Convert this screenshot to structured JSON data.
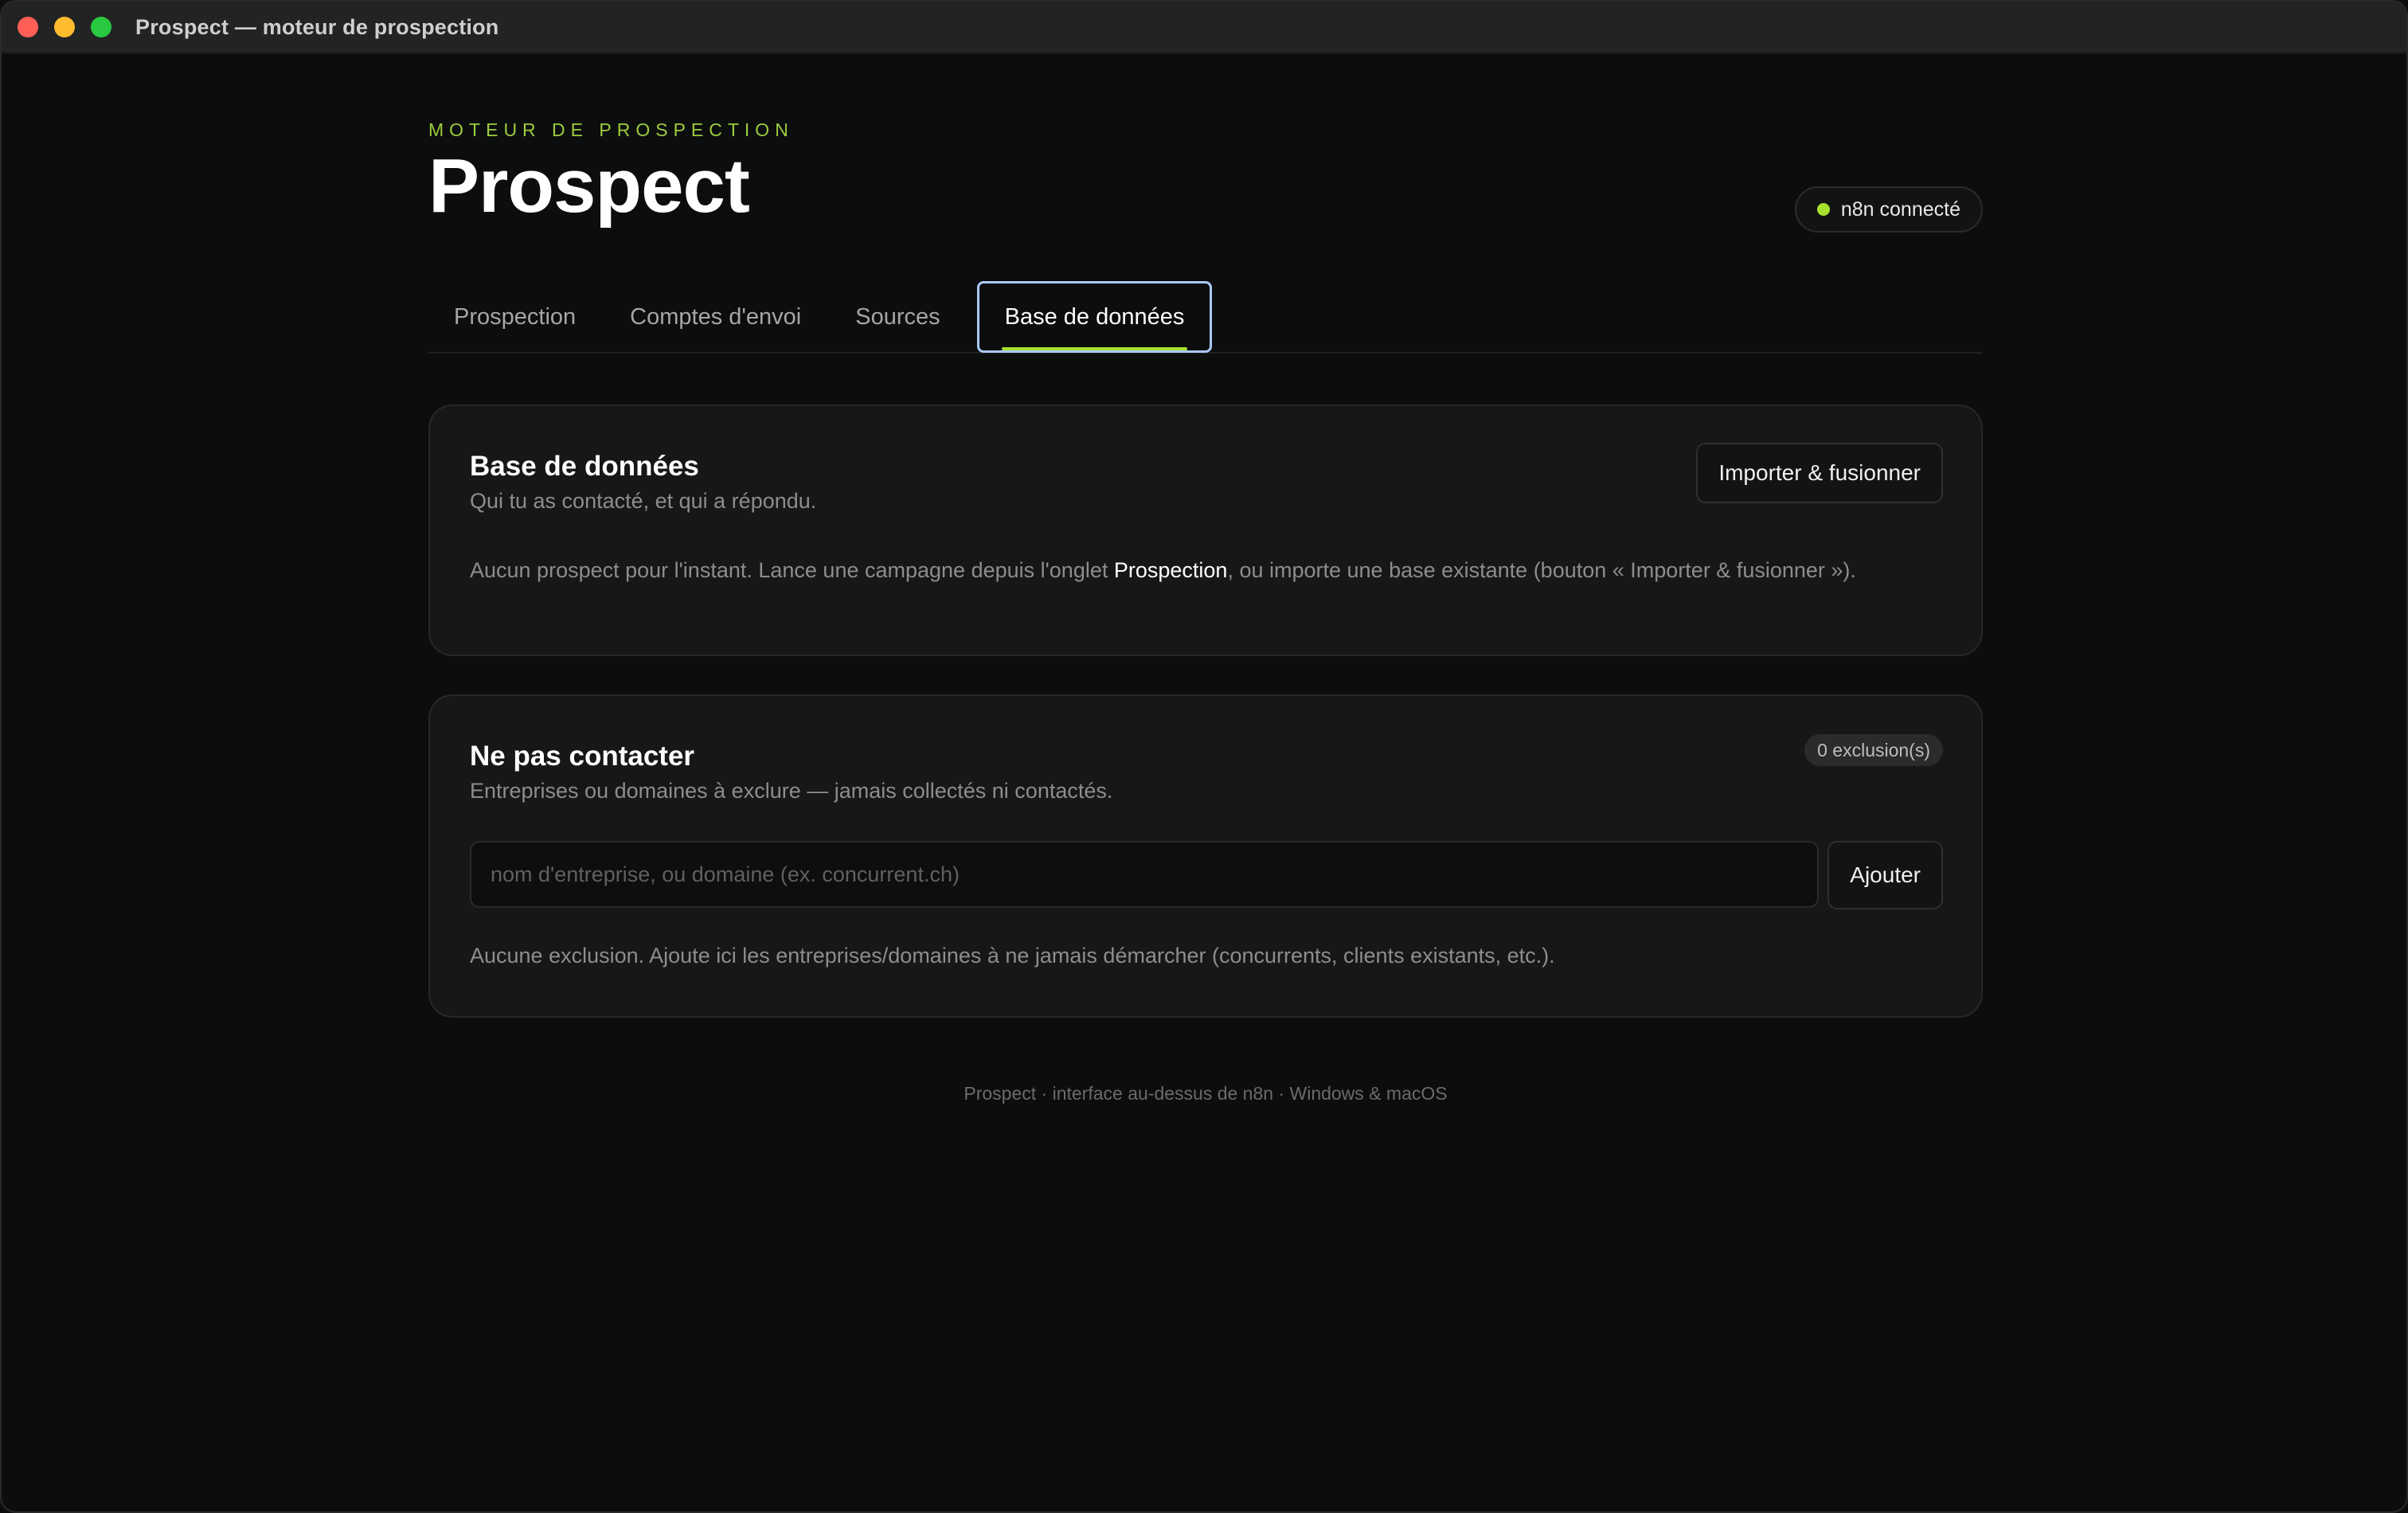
{
  "window": {
    "title": "Prospect — moteur de prospection"
  },
  "header": {
    "eyebrow": "MOTEUR DE PROSPECTION",
    "title": "Prospect",
    "status": {
      "text": "n8n connecté",
      "color": "#a6e22e"
    }
  },
  "tabs": [
    {
      "label": "Prospection",
      "active": false
    },
    {
      "label": "Comptes d'envoi",
      "active": false
    },
    {
      "label": "Sources",
      "active": false
    },
    {
      "label": "Base de données",
      "active": true
    }
  ],
  "database_card": {
    "title": "Base de données",
    "subtitle": "Qui tu as contacté, et qui a répondu.",
    "import_button": "Importer & fusionner",
    "empty_before": "Aucun prospect pour l'instant. Lance une campagne depuis l'onglet ",
    "empty_link": "Prospection",
    "empty_after": ", ou importe une base existante (bouton « Importer & fusionner »)."
  },
  "do_not_contact_card": {
    "title": "Ne pas contacter",
    "subtitle": "Entreprises ou domaines à exclure — jamais collectés ni contactés.",
    "count_badge": "0 exclusion(s)",
    "input_value": "",
    "input_placeholder": "nom d'entreprise, ou domaine (ex. concurrent.ch)",
    "add_button": "Ajouter",
    "empty_text": "Aucune exclusion. Ajoute ici les entreprises/domaines à ne jamais démarcher (concurrents, clients existants, etc.)."
  },
  "footer": {
    "text": "Prospect · interface au-dessus de n8n · Windows & macOS"
  },
  "colors": {
    "accent": "#a6e22e",
    "eyebrow": "#9ccc3f",
    "focus_ring": "#a9c9ff"
  }
}
